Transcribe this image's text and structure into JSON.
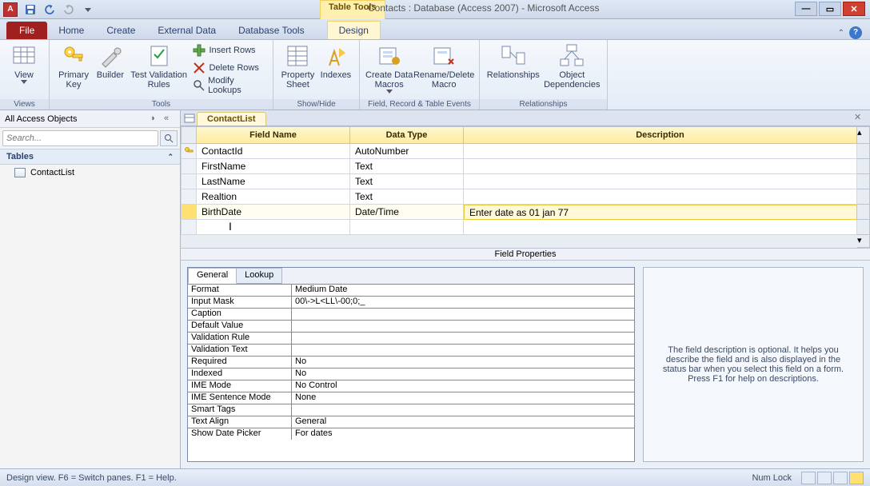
{
  "window": {
    "title": "Contacts : Database (Access 2007)  -  Microsoft Access",
    "table_tools": "Table Tools"
  },
  "ribbon_tabs": {
    "file": "File",
    "home": "Home",
    "create": "Create",
    "external": "External Data",
    "dbtools": "Database Tools",
    "design": "Design"
  },
  "ribbon": {
    "views_group": "Views",
    "tools_group": "Tools",
    "showhide_group": "Show/Hide",
    "events_group": "Field, Record & Table Events",
    "rel_group": "Relationships",
    "view": "View",
    "primary_key": "Primary\nKey",
    "builder": "Builder",
    "test_validation": "Test Validation\nRules",
    "insert_rows": "Insert Rows",
    "delete_rows": "Delete Rows",
    "modify_lookups": "Modify Lookups",
    "property_sheet": "Property\nSheet",
    "indexes": "Indexes",
    "create_data_macros": "Create Data\nMacros",
    "rename_delete_macro": "Rename/Delete\nMacro",
    "relationships": "Relationships",
    "object_deps": "Object\nDependencies"
  },
  "nav": {
    "header": "All Access Objects",
    "search_placeholder": "Search...",
    "section_tables": "Tables",
    "item_contactlist": "ContactList"
  },
  "doc": {
    "tab": "ContactList",
    "col_field": "Field Name",
    "col_type": "Data Type",
    "col_desc": "Description",
    "rows": [
      {
        "field": "ContactId",
        "type": "AutoNumber",
        "desc": "",
        "pk": true
      },
      {
        "field": "FirstName",
        "type": "Text",
        "desc": ""
      },
      {
        "field": "LastName",
        "type": "Text",
        "desc": ""
      },
      {
        "field": "Realtion",
        "type": "Text",
        "desc": ""
      },
      {
        "field": "BirthDate",
        "type": "Date/Time",
        "desc": "Enter date as 01 jan 77",
        "selected": true
      }
    ]
  },
  "field_props": {
    "header": "Field Properties",
    "tab_general": "General",
    "tab_lookup": "Lookup",
    "rows": [
      {
        "label": "Format",
        "value": "Medium Date"
      },
      {
        "label": "Input Mask",
        "value": "00\\->L<LL\\-00;0;_"
      },
      {
        "label": "Caption",
        "value": ""
      },
      {
        "label": "Default Value",
        "value": ""
      },
      {
        "label": "Validation Rule",
        "value": ""
      },
      {
        "label": "Validation Text",
        "value": ""
      },
      {
        "label": "Required",
        "value": "No"
      },
      {
        "label": "Indexed",
        "value": "No"
      },
      {
        "label": "IME Mode",
        "value": "No Control"
      },
      {
        "label": "IME Sentence Mode",
        "value": "None"
      },
      {
        "label": "Smart Tags",
        "value": ""
      },
      {
        "label": "Text Align",
        "value": "General"
      },
      {
        "label": "Show Date Picker",
        "value": "For dates"
      }
    ],
    "help_text": "The field description is optional. It helps you describe the field and is also displayed in the status bar when you select this field on a form. Press F1 for help on descriptions."
  },
  "status": {
    "left": "Design view.  F6 = Switch panes.  F1 = Help.",
    "numlock": "Num Lock"
  }
}
